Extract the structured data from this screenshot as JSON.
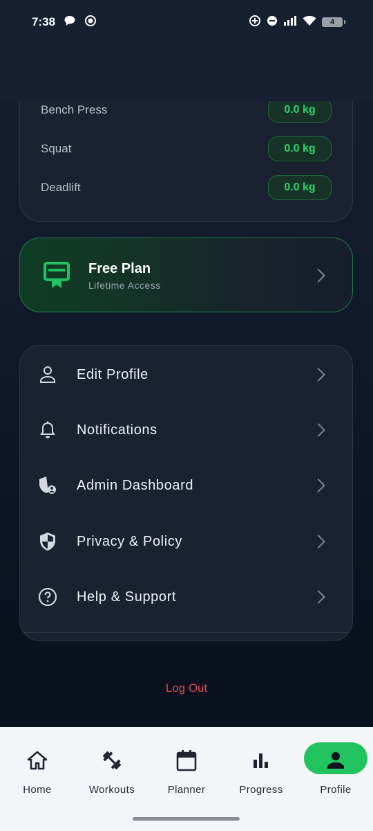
{
  "status_bar": {
    "time": "7:38",
    "battery": "4",
    "icons": [
      "chat-bubble-icon",
      "record-icon",
      "data-saver-icon",
      "do-not-disturb-icon",
      "signal-icon",
      "wifi-icon",
      "battery-icon"
    ]
  },
  "lifts": [
    {
      "name": "Bench Press",
      "value": "0.0 kg"
    },
    {
      "name": "Squat",
      "value": "0.0 kg"
    },
    {
      "name": "Deadlift",
      "value": "0.0 kg"
    }
  ],
  "plan": {
    "title": "Free Plan",
    "subtitle": "Lifetime Access",
    "icon": "membership-card-icon"
  },
  "menu": [
    {
      "label": "Edit Profile",
      "icon": "person-icon"
    },
    {
      "label": "Notifications",
      "icon": "bell-icon"
    },
    {
      "label": "Admin Dashboard",
      "icon": "admin-shield-icon"
    },
    {
      "label": "Privacy & Policy",
      "icon": "shield-icon"
    },
    {
      "label": "Help & Support",
      "icon": "help-circle-icon"
    }
  ],
  "logout_label": "Log Out",
  "nav": [
    {
      "label": "Home",
      "icon": "home-icon"
    },
    {
      "label": "Workouts",
      "icon": "dumbbell-icon"
    },
    {
      "label": "Planner",
      "icon": "calendar-icon"
    },
    {
      "label": "Progress",
      "icon": "bar-chart-icon"
    },
    {
      "label": "Profile",
      "icon": "person-icon",
      "active": true
    }
  ],
  "colors": {
    "accent": "#22c35e",
    "badge_text": "#2bd36b",
    "logout": "#e5484d",
    "background": "#111a2a"
  }
}
